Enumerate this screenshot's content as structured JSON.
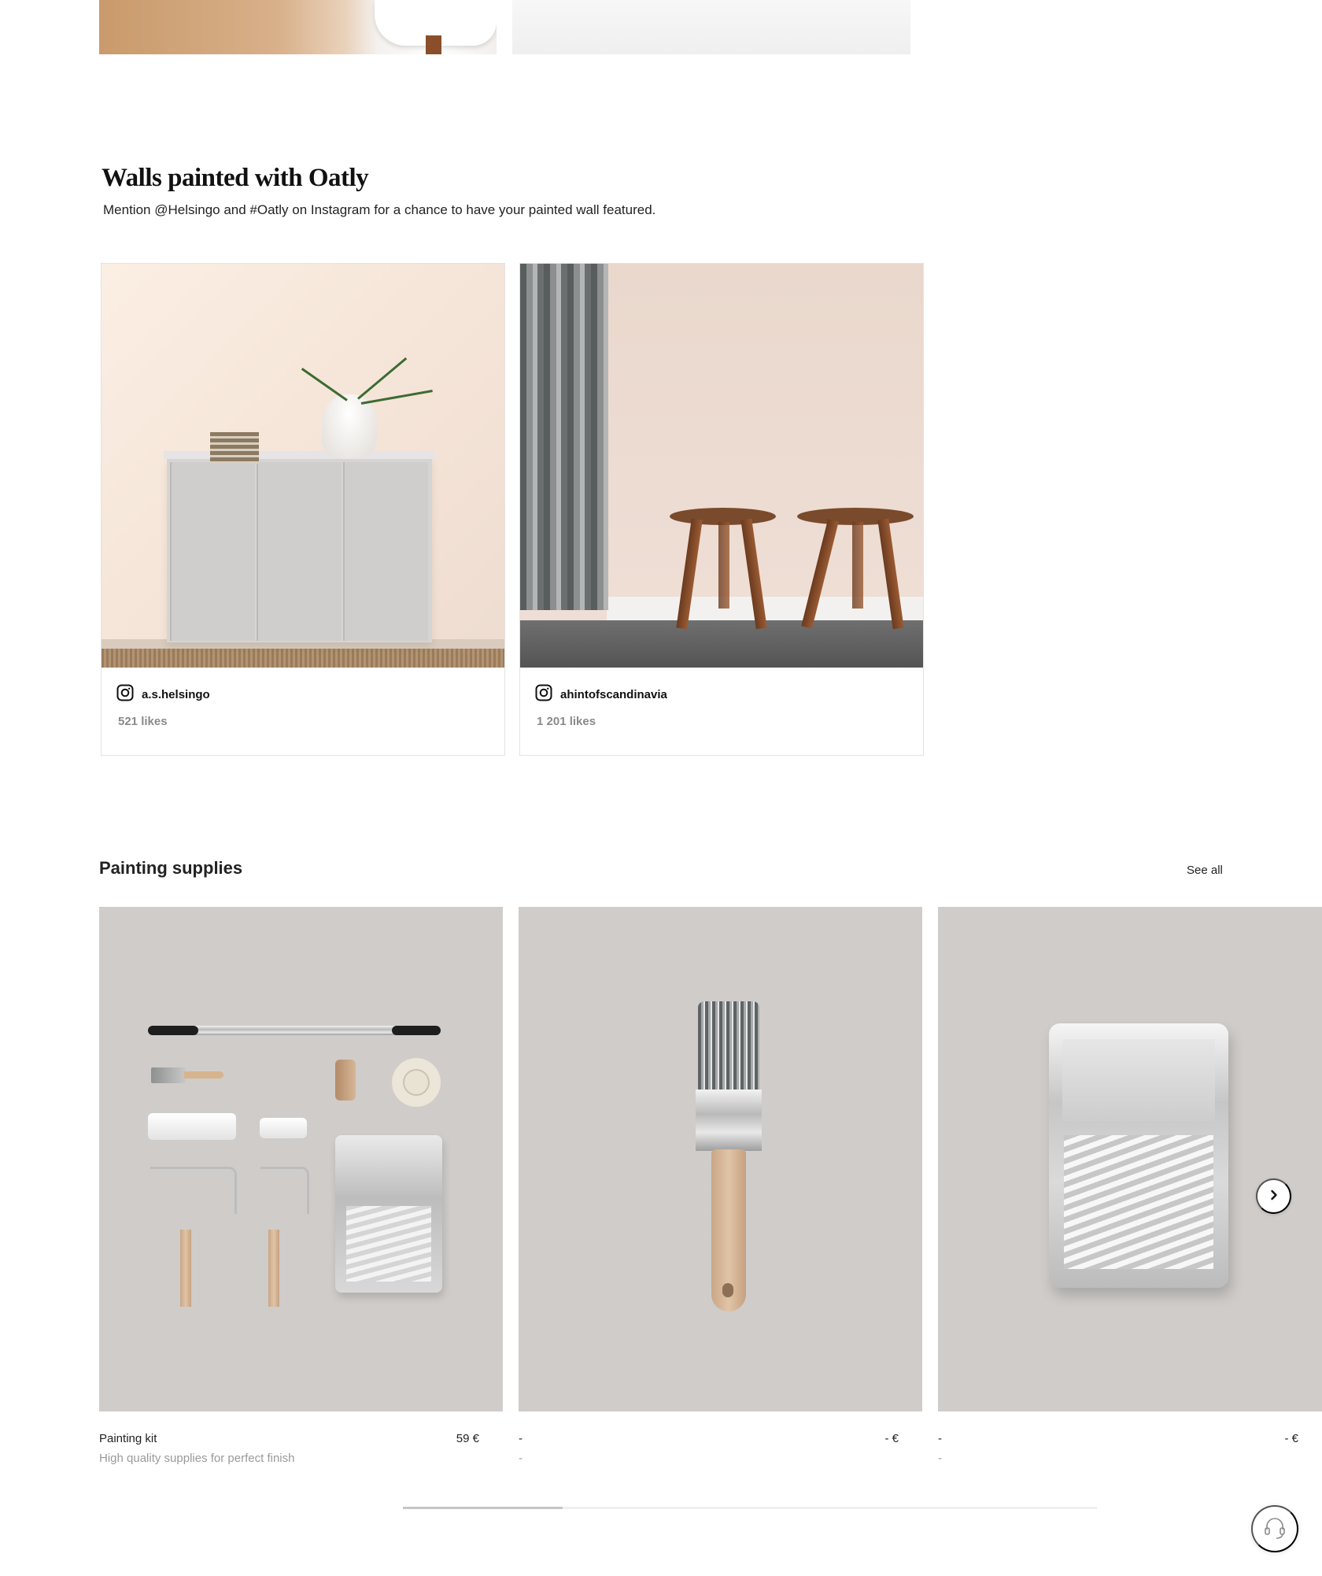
{
  "gallery": {
    "title": "Walls painted with Oatly",
    "subtitle": "Mention @Helsingo and #Oatly on Instagram for a chance to have your painted wall featured.",
    "posts": [
      {
        "handle": "a.s.helsingo",
        "likes": "521 likes",
        "icon": "instagram-icon"
      },
      {
        "handle": "ahintofscandinavia",
        "likes": "1 201 likes",
        "icon": "instagram-icon"
      }
    ]
  },
  "supplies": {
    "title": "Painting supplies",
    "see_all": "See all",
    "products": [
      {
        "name": "Painting kit",
        "price": "59 €",
        "description": "High quality supplies for perfect finish"
      },
      {
        "name": "-",
        "price": "- €",
        "description": "-"
      },
      {
        "name": "-",
        "price": "- €",
        "description": "-"
      }
    ],
    "next_icon": "chevron-right-icon",
    "carousel_scroll_fraction": 0.23
  },
  "support": {
    "icon": "headset-icon"
  },
  "colors": {
    "accent_text": "#1a1a1a",
    "muted_text": "#8a8a8a",
    "product_bg": "#d0ccca"
  }
}
